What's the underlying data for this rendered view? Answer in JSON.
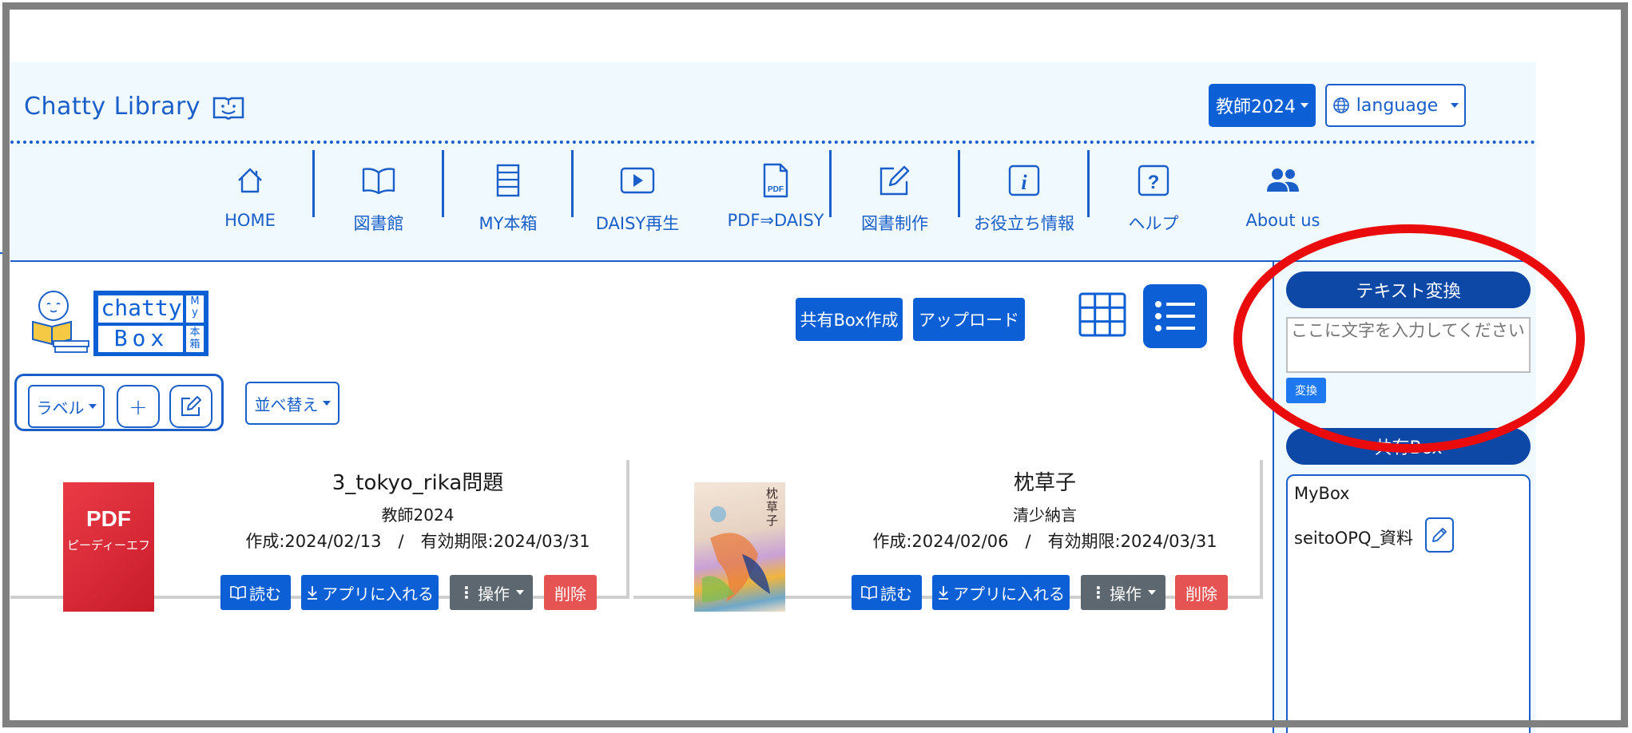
{
  "header": {
    "brand": "Chatty Library",
    "user_menu": "教師2024",
    "language": "language"
  },
  "nav": [
    {
      "label": "HOME",
      "icon": "home-icon"
    },
    {
      "label": "図書館",
      "icon": "book-open-icon"
    },
    {
      "label": "MY本箱",
      "icon": "bookshelf-icon"
    },
    {
      "label": "DAISY再生",
      "icon": "play-icon"
    },
    {
      "label": "PDF⇒DAISY",
      "icon": "pdf-file-icon"
    },
    {
      "label": "図書制作",
      "icon": "edit-icon"
    },
    {
      "label": "お役立ち情報",
      "icon": "info-icon"
    },
    {
      "label": "ヘルプ",
      "icon": "help-icon"
    },
    {
      "label": "About us",
      "icon": "people-icon"
    }
  ],
  "mybox_logo": {
    "line1": "chatty",
    "line2": "Box",
    "side1": "My",
    "side2": "本箱"
  },
  "toolbar": {
    "create_share_box": "共有Box作成",
    "upload": "アップロード",
    "label": "ラベル",
    "add": "+",
    "sort": "並べ替え"
  },
  "cards": [
    {
      "title": "3_tokyo_rika問題",
      "author": "教師2024",
      "dates": "作成:2024/02/13　/　有効期限:2024/03/31",
      "cover_text1": "PDF",
      "cover_text2": "ピーディーエフ",
      "read": "読む",
      "add_app": "アプリに入れる",
      "ops": "操作",
      "delete": "削除"
    },
    {
      "title": "枕草子",
      "author": "清少納言",
      "dates": "作成:2024/02/06　/　有効期限:2024/03/31",
      "cover_text1": "枕草子",
      "read": "読む",
      "add_app": "アプリに入れる",
      "ops": "操作",
      "delete": "削除"
    }
  ],
  "sidebar": {
    "text_convert_title": "テキスト変換",
    "text_placeholder": "ここに文字を入力してください",
    "convert_button": "変換",
    "share_box_title": "共有Box",
    "items": [
      "MyBox",
      "seitoOPQ_資料"
    ]
  },
  "colors": {
    "primary": "#0d5fd6",
    "header_bg": "#f0f9fe",
    "annotation": "#ea0c0c",
    "delete": "#e55353"
  }
}
